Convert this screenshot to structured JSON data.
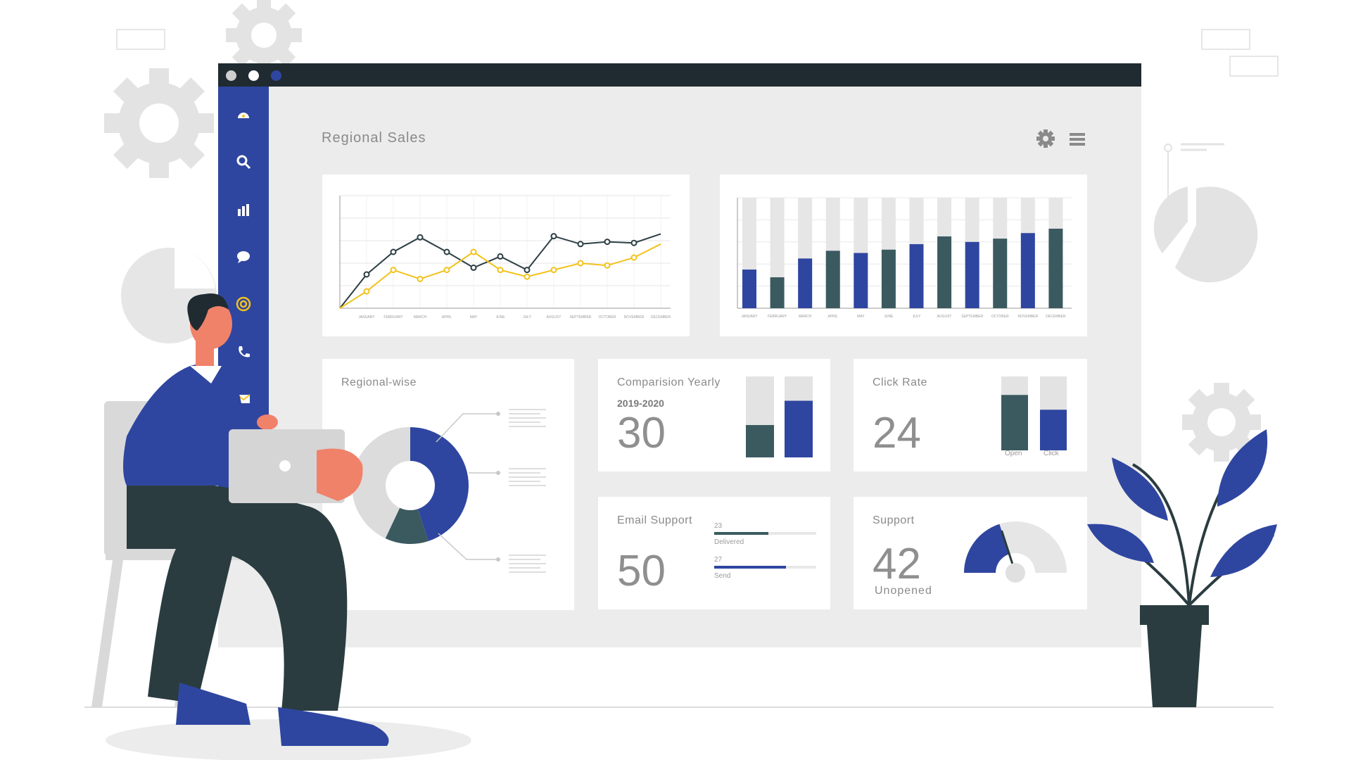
{
  "dashboard": {
    "title": "Regional Sales",
    "toolbar": {
      "settings_icon": "gear-icon",
      "menu_icon": "hamburger-menu-icon"
    }
  },
  "window": {
    "dot_colors": [
      "#cfcfcf",
      "#ffffff",
      "#2f46a0"
    ]
  },
  "sidebar": {
    "items": [
      {
        "icon": "dashboard-gauge-icon"
      },
      {
        "icon": "search-icon"
      },
      {
        "icon": "bar-chart-icon"
      },
      {
        "icon": "chat-bubble-icon"
      },
      {
        "icon": "at-sign-icon"
      },
      {
        "icon": "phone-icon"
      },
      {
        "icon": "mail-icon"
      }
    ]
  },
  "cards": {
    "regional": {
      "title": "Regional-wise"
    },
    "comparison": {
      "title": "Comparision Yearly",
      "period": "2019-2020",
      "value": "30"
    },
    "click_rate": {
      "title": "Click Rate",
      "value": "24",
      "open_label": "Open",
      "click_label": "Click"
    },
    "email_support": {
      "title": "Email Support",
      "value": "50",
      "delivered_value": "23",
      "delivered_label": "Delivered",
      "send_value": "27",
      "send_label": "Send"
    },
    "support": {
      "title": "Support",
      "value": "42",
      "caption": "Unopened"
    }
  },
  "chart_data": [
    {
      "type": "line",
      "categories": [
        "JANUARY",
        "FEBRUARY",
        "MARCH",
        "APRIL",
        "MAY",
        "JUNE",
        "JULY",
        "AUGUST",
        "SEPTEMBER",
        "OCTOBER",
        "NOVEMBER",
        "DECEMBER"
      ],
      "series": [
        {
          "values": [
            3,
            5,
            6.3,
            5,
            3.6,
            4.6,
            3.4,
            6.4,
            5.7,
            5.9,
            5.8,
            6.6
          ],
          "color": "#2c3e44"
        },
        {
          "values": [
            1.5,
            3.4,
            2.6,
            3.4,
            5,
            3.4,
            2.8,
            3.4,
            4,
            3.8,
            4.5,
            5.7
          ],
          "color": "#f2c21b"
        }
      ],
      "ylim": [
        0,
        10
      ],
      "grid": true
    },
    {
      "type": "bar",
      "categories": [
        "JANUARY",
        "FEBRUARY",
        "MARCH",
        "APRIL",
        "MAY",
        "JUNE",
        "JULY",
        "AUGUST",
        "SEPTEMBER",
        "OCTOBER",
        "NOVEMBER",
        "DECEMBER"
      ],
      "values": [
        35,
        28,
        45,
        52,
        50,
        53,
        58,
        65,
        60,
        63,
        68,
        72
      ],
      "bar_colors": [
        "#2f46a0",
        "#3b5a60",
        "#2f46a0",
        "#3b5a60",
        "#2f46a0",
        "#3b5a60",
        "#2f46a0",
        "#3b5a60",
        "#2f46a0",
        "#3b5a60",
        "#2f46a0",
        "#3b5a60"
      ],
      "ylim": [
        0,
        100
      ],
      "grid": true
    },
    {
      "type": "pie",
      "slices": [
        {
          "value": 45,
          "color": "#2f46a0"
        },
        {
          "value": 12,
          "color": "#3b5a60"
        },
        {
          "value": 43,
          "color": "#dcdcdc"
        }
      ]
    },
    {
      "type": "bar",
      "values": [
        40,
        70
      ],
      "bar_colors": [
        "#3b5a60",
        "#2f46a0"
      ],
      "ylim": [
        0,
        100
      ]
    },
    {
      "type": "bar",
      "categories": [
        "Open",
        "Click"
      ],
      "values": [
        75,
        55
      ],
      "bar_colors": [
        "#3b5a60",
        "#2f46a0"
      ],
      "ylim": [
        0,
        100
      ]
    }
  ],
  "progress": {
    "delivered_fraction": 0.53,
    "send_fraction": 0.7
  },
  "gauge": {
    "fraction": 0.4
  }
}
